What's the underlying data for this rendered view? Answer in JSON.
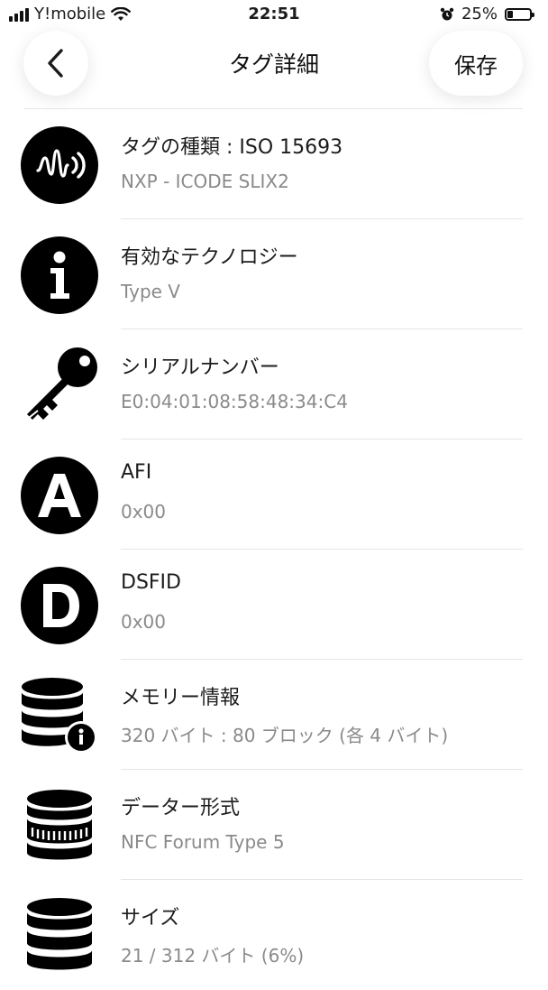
{
  "status_bar": {
    "carrier": "Y!mobile",
    "time": "22:51",
    "battery_percent_label": "25%",
    "battery_level": 0.25
  },
  "header": {
    "title": "タグ詳細",
    "save_label": "保存"
  },
  "rows": [
    {
      "icon": "nfc-wave-icon",
      "label": "タグの種類 : ISO 15693",
      "value": "NXP - ICODE SLIX2"
    },
    {
      "icon": "info-icon",
      "label": "有効なテクノロジー",
      "value": "Type V"
    },
    {
      "icon": "key-icon",
      "label": "シリアルナンバー",
      "value": "E0:04:01:08:58:48:34:C4"
    },
    {
      "icon": "letter-a-icon",
      "label": "AFI",
      "value": "0x00"
    },
    {
      "icon": "letter-d-icon",
      "label": "DSFID",
      "value": "0x00"
    },
    {
      "icon": "database-info-icon",
      "label": "メモリー情報",
      "value": "320 バイト : 80 ブロック (各 4 バイト)"
    },
    {
      "icon": "coin-stack-icon",
      "label": "データー形式",
      "value": "NFC Forum Type 5"
    },
    {
      "icon": "database-icon",
      "label": "サイズ",
      "value": "21 / 312 バイト (6%)"
    }
  ]
}
